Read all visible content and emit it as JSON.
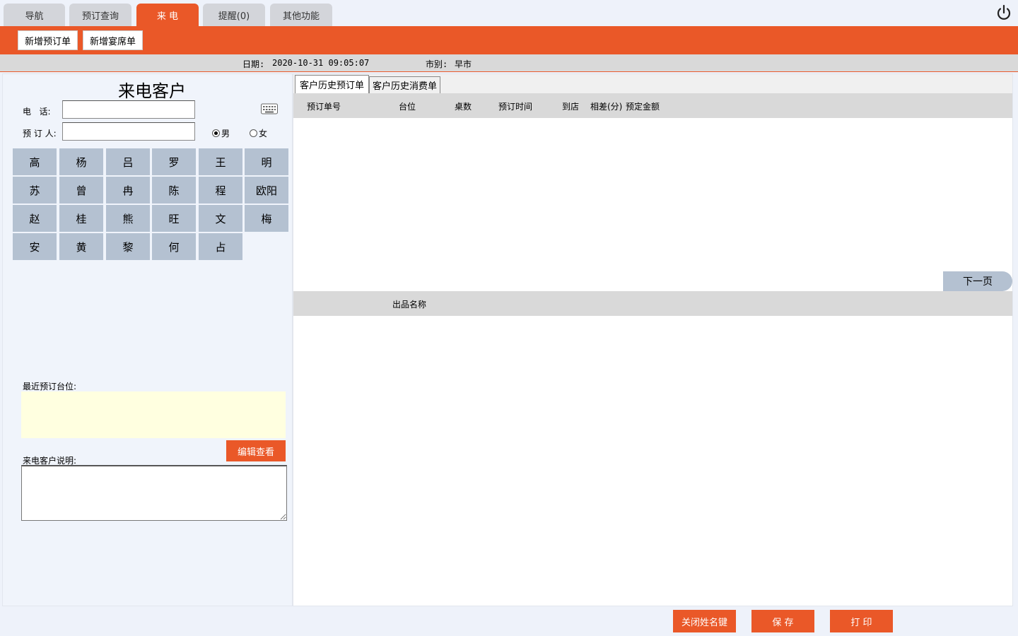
{
  "top_tabs": [
    {
      "label": "导航"
    },
    {
      "label": "预订查询"
    },
    {
      "label": "来 电"
    },
    {
      "label": "提醒(0)"
    },
    {
      "label": "其他功能"
    }
  ],
  "toolbar": {
    "new_booking": "新增预订单",
    "new_banquet": "新增宴席单"
  },
  "info": {
    "date_label": "日期:",
    "date_value": "2020-10-31 09:05:07",
    "market_label": "市别:",
    "market_value": "早市"
  },
  "caller": {
    "title": "来电客户",
    "phone_label": "电   话:",
    "booker_label": "预 订 人:",
    "phone_value": "",
    "booker_value": "",
    "gender_male": "男",
    "gender_female": "女",
    "gender_selected": "男",
    "surnames": [
      "高",
      "杨",
      "吕",
      "罗",
      "王",
      "明",
      "苏",
      "曾",
      "冉",
      "陈",
      "程",
      "欧阳",
      "赵",
      "桂",
      "熊",
      "旺",
      "文",
      "梅",
      "安",
      "黄",
      "黎",
      "何",
      "占"
    ],
    "recent_label": "最近预订台位:",
    "edit_btn": "编辑查看",
    "note_label": "来电客户说明:"
  },
  "history": {
    "tabs": [
      "客户历史预订单",
      "客户历史消费单"
    ],
    "columns": [
      "预订单号",
      "台位",
      "桌数",
      "预订时间",
      "到店",
      "相差(分)",
      "预定金额"
    ],
    "next_page": "下一页",
    "detail_column": "出品名称"
  },
  "footer": {
    "close_surname": "关闭姓名键",
    "save": "保 存",
    "print": "打 印"
  },
  "colors": {
    "accent": "#ea5828",
    "key_bg": "#b4c1d1",
    "recent_bg": "#ffffe0"
  }
}
